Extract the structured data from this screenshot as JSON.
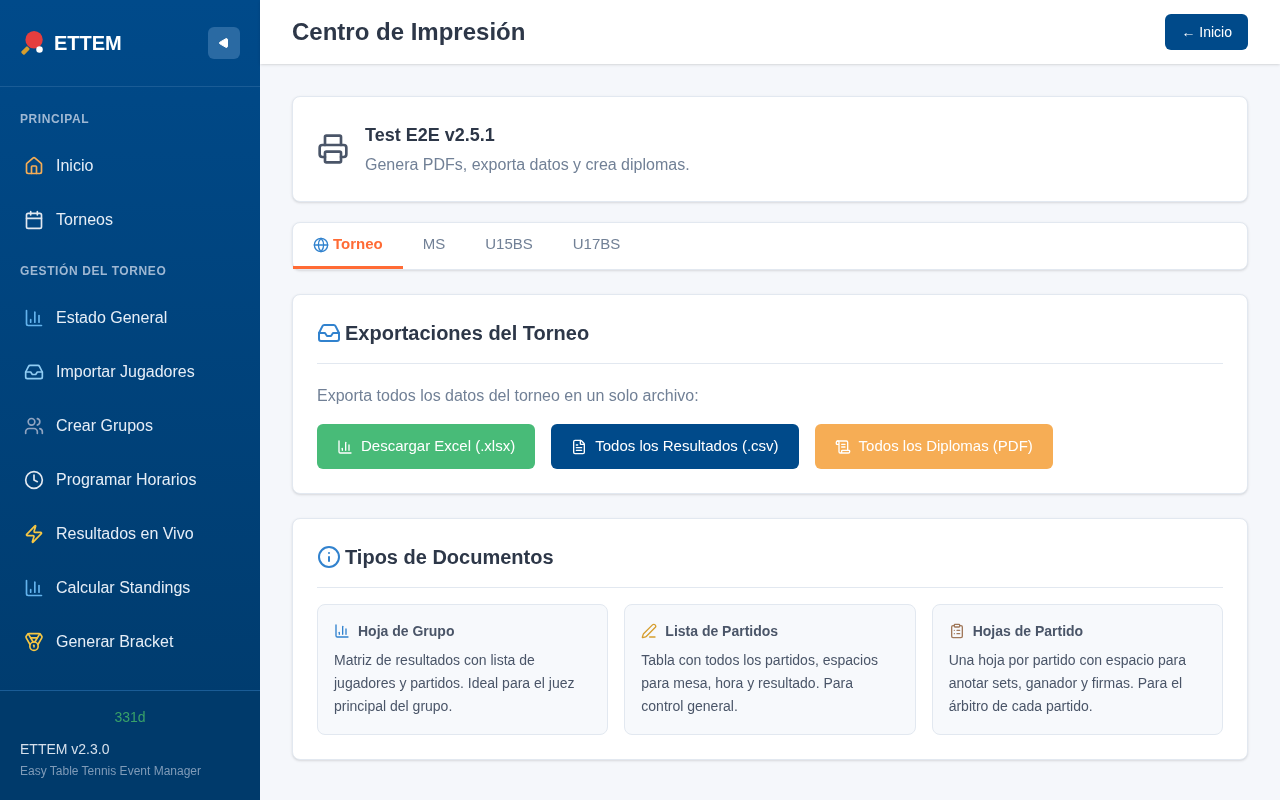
{
  "sidebar": {
    "brand": "ETTEM",
    "sections": [
      {
        "title": "PRINCIPAL",
        "items": [
          {
            "label": "Inicio"
          },
          {
            "label": "Torneos"
          }
        ]
      },
      {
        "title": "GESTIÓN DEL TORNEO",
        "items": [
          {
            "label": "Estado General"
          },
          {
            "label": "Importar Jugadores"
          },
          {
            "label": "Crear Grupos"
          },
          {
            "label": "Programar Horarios"
          },
          {
            "label": "Resultados en Vivo"
          },
          {
            "label": "Calcular Standings"
          },
          {
            "label": "Generar Bracket"
          }
        ]
      }
    ],
    "footer": {
      "badge": "331d",
      "version": "ETTEM v2.3.0",
      "tagline": "Easy Table Tennis Event Manager"
    }
  },
  "header": {
    "title": "Centro de Impresión",
    "back_button": "← Inicio"
  },
  "tournament": {
    "name": "Test E2E v2.5.1",
    "subtitle": "Genera PDFs, exporta datos y crea diplomas."
  },
  "tabs": [
    {
      "label": "Torneo",
      "selected": true
    },
    {
      "label": "MS",
      "selected": false
    },
    {
      "label": "U15BS",
      "selected": false
    },
    {
      "label": "U17BS",
      "selected": false
    }
  ],
  "exports": {
    "title": "Exportaciones del Torneo",
    "description": "Exporta todos los datos del torneo en un solo archivo:",
    "buttons": [
      {
        "label": "Descargar Excel (.xlsx)",
        "color": "#48bb78"
      },
      {
        "label": "Todos los Resultados (.csv)",
        "color": "#004a8a"
      },
      {
        "label": "Todos los Diplomas (PDF)",
        "color": "#f6ad55"
      }
    ]
  },
  "doc_types": {
    "title": "Tipos de Documentos",
    "cards": [
      {
        "title": "Hoja de Grupo",
        "text": "Matriz de resultados con lista de jugadores y partidos. Ideal para el juez principal del grupo."
      },
      {
        "title": "Lista de Partidos",
        "text": "Tabla con todos los partidos, espacios para mesa, hora y resultado. Para control general."
      },
      {
        "title": "Hojas de Partido",
        "text": "Una hoja por partido con espacio para anotar sets, ganador y firmas. Para el árbitro de cada partido."
      }
    ]
  }
}
